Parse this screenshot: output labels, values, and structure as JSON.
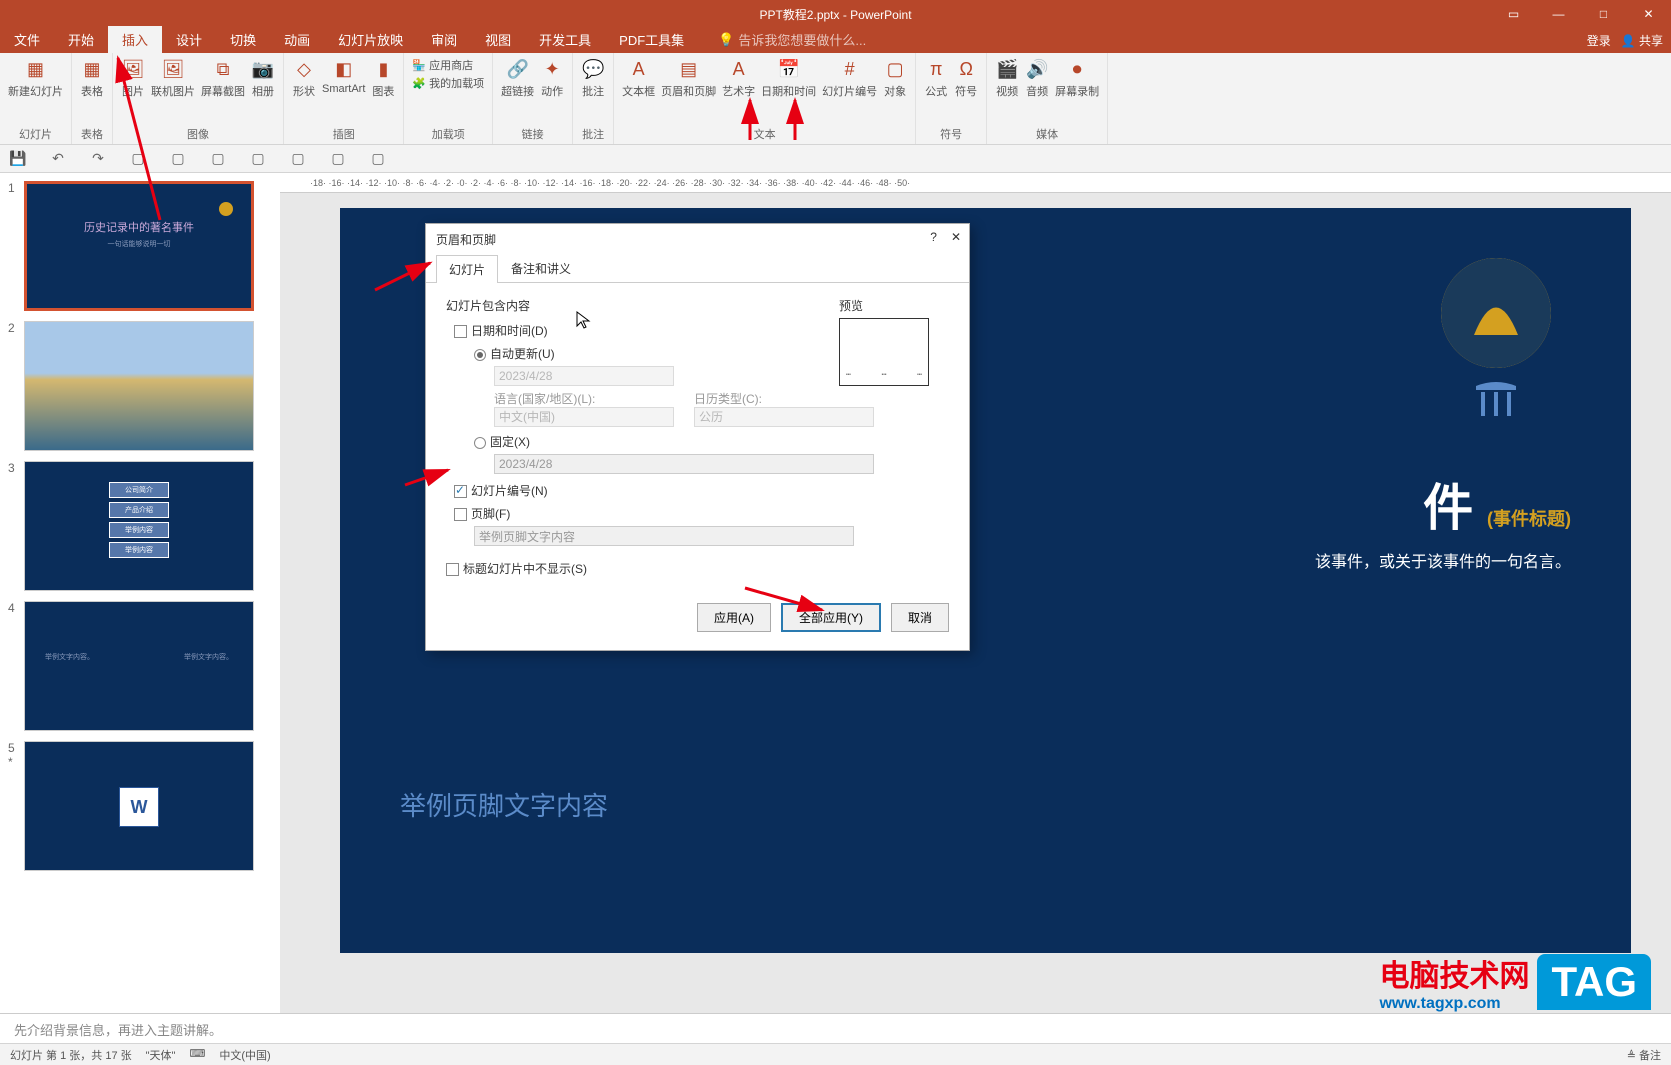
{
  "app": {
    "title": "PPT教程2.pptx - PowerPoint",
    "login": "登录",
    "share": "共享"
  },
  "tabs": {
    "file": "文件",
    "home": "开始",
    "insert": "插入",
    "design": "设计",
    "transition": "切换",
    "animation": "动画",
    "slideshow": "幻灯片放映",
    "review": "审阅",
    "view": "视图",
    "developer": "开发工具",
    "pdf": "PDF工具集",
    "tellme": "告诉我您想要做什么..."
  },
  "ribbon": {
    "new_slide": "新建幻灯片",
    "table": "表格",
    "picture": "图片",
    "online_pic": "联机图片",
    "screenshot": "屏幕截图",
    "album": "相册",
    "shapes": "形状",
    "smartart": "SmartArt",
    "chart": "图表",
    "appstore": "应用商店",
    "myaddins": "我的加载项",
    "hyperlink": "超链接",
    "action": "动作",
    "comment": "批注",
    "textbox": "文本框",
    "header_footer": "页眉和页脚",
    "wordart": "艺术字",
    "datetime": "日期和时间",
    "slidenum": "幻灯片编号",
    "object": "对象",
    "equation": "公式",
    "symbol": "符号",
    "video": "视频",
    "audio": "音频",
    "screenrec": "屏幕录制",
    "grp_slides": "幻灯片",
    "grp_tables": "表格",
    "grp_images": "图像",
    "grp_illustrations": "插图",
    "grp_addins": "加载项",
    "grp_links": "链接",
    "grp_comments": "批注",
    "grp_text": "文本",
    "grp_symbols": "符号",
    "grp_media": "媒体"
  },
  "slides": {
    "s1_title": "历史记录中的著名事件",
    "s1_sub": "一句话能够说明一切",
    "s3_b1": "公司简介",
    "s3_b2": "产品介绍",
    "s3_b3": "举例内容",
    "s3_b4": "举例内容",
    "s4_t1": "举例文字内容。",
    "s4_t2": "举例文字内容。"
  },
  "canvas": {
    "big_char": "件",
    "subtitle_label": "(事件标题)",
    "body_text": "该事件，或关于该事件的一句名言。",
    "footer_sample": "举例页脚文字内容"
  },
  "notes": {
    "text": "先介绍背景信息，再进入主题讲解。"
  },
  "statusbar": {
    "slide_info": "幻灯片 第 1 张，共 17 张",
    "theme": "\"天体\"",
    "lang": "中文(中国)",
    "notes_btn": "备注"
  },
  "dialog": {
    "title": "页眉和页脚",
    "tab_slide": "幻灯片",
    "tab_notes": "备注和讲义",
    "group_label": "幻灯片包含内容",
    "preview_label": "预览",
    "datetime": "日期和时间(D)",
    "auto_update": "自动更新(U)",
    "date_value": "2023/4/28",
    "lang_label": "语言(国家/地区)(L):",
    "lang_value": "中文(中国)",
    "cal_label": "日历类型(C):",
    "cal_value": "公历",
    "fixed": "固定(X)",
    "fixed_value": "2023/4/28",
    "slide_number": "幻灯片编号(N)",
    "footer": "页脚(F)",
    "footer_placeholder": "举例页脚文字内容",
    "hide_title": "标题幻灯片中不显示(S)",
    "apply": "应用(A)",
    "apply_all": "全部应用(Y)",
    "cancel": "取消"
  },
  "watermark": {
    "text1": "电脑技术网",
    "text2": "www.tagxp.com",
    "tag": "TAG"
  }
}
